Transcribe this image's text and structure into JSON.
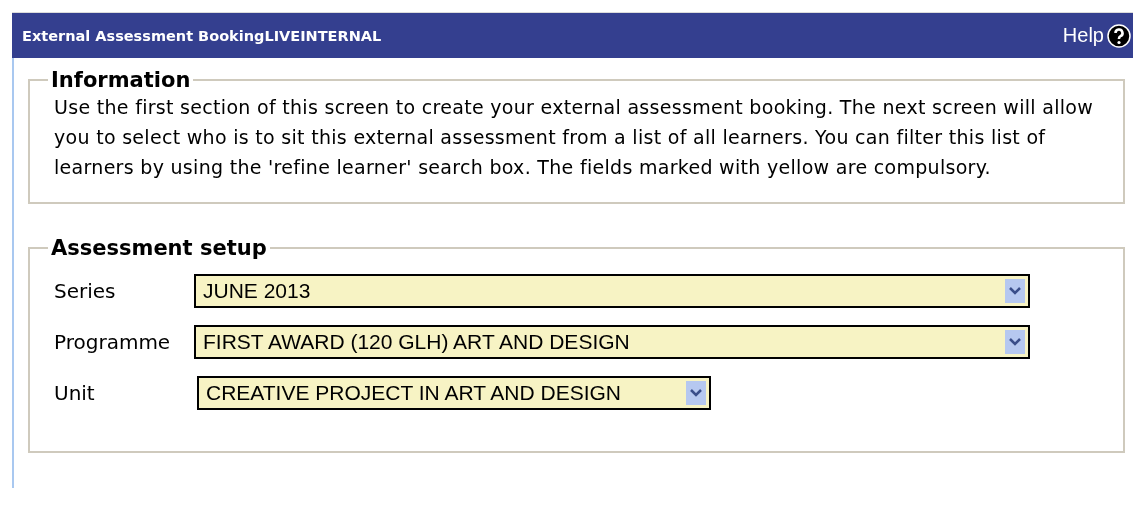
{
  "header": {
    "title": "External Assessment BookingLIVEINTERNAL",
    "help": "Help"
  },
  "information": {
    "legend": "Information",
    "text": "Use the first section of this screen to create your external assessment booking. The next screen will allow you to select who is to sit this external assessment from a list of all learners. You can filter this list of learners by using the 'refine learner' search box. The fields marked with yellow are compulsory."
  },
  "setup": {
    "legend": "Assessment setup",
    "fields": [
      {
        "label": "Series",
        "value": "JUNE 2013",
        "compulsory": true,
        "wide": true
      },
      {
        "label": "Programme",
        "value": "FIRST AWARD (120 GLH) ART AND DESIGN",
        "compulsory": true,
        "wide": true
      },
      {
        "label": "Unit",
        "value": "CREATIVE PROJECT IN ART AND DESIGN",
        "compulsory": true,
        "wide": false
      }
    ]
  }
}
